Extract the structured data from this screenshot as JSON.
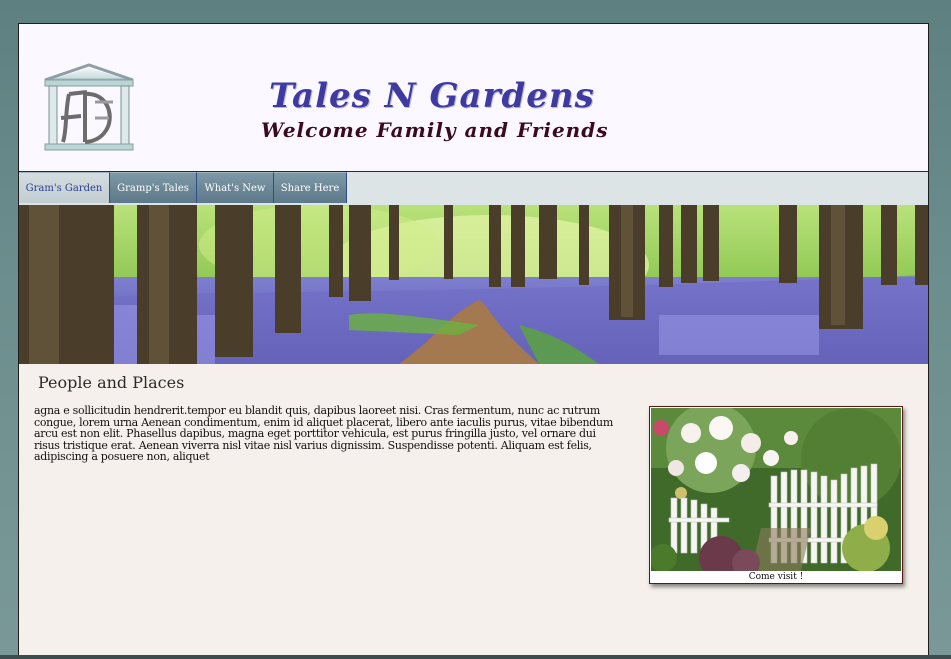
{
  "header": {
    "title": "Tales N Gardens",
    "subtitle": "Welcome Family and Friends",
    "logo_icon": "house-monogram-logo-icon"
  },
  "nav": {
    "items": [
      {
        "label": "Gram's Garden",
        "active": true
      },
      {
        "label": "Gramp's Tales",
        "active": false
      },
      {
        "label": "What's New",
        "active": false
      },
      {
        "label": "Share Here",
        "active": false
      }
    ]
  },
  "banner": {
    "icon": "bluebell-forest-image"
  },
  "main": {
    "heading": "People and Places",
    "body": "agna e sollicitudin hendrerit.tempor eu blandit quis, dapibus laoreet nisi. Cras fermentum, nunc ac rutrum congue, lorem urna Aenean condimentum, enim id aliquet placerat, libero ante iaculis purus, vitae bibendum arcu est non elit. Phasellus dapibus, magna eget porttitor vehicula, est purus fringilla justo, vel ornare dui risus tristique erat. Aenean viverra nisl vitae nisl varius dignissim. Suspendisse potenti. Aliquam est felis, adipiscing a posuere non, aliquet",
    "photo": {
      "caption": "Come visit !",
      "icon": "garden-gate-image"
    }
  },
  "colors": {
    "title": "#3f3aa0",
    "subtitle": "#3a0a22",
    "nav_bg": "#6a8696",
    "page_bg": "#f5f0eb"
  }
}
